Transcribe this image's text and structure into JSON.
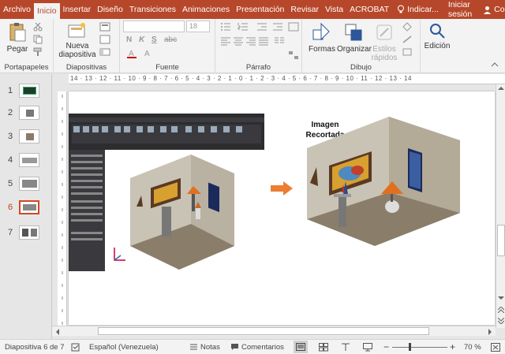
{
  "tabs": [
    "Archivo",
    "Inicio",
    "Insertar",
    "Diseño",
    "Transiciones",
    "Animaciones",
    "Presentación",
    "Revisar",
    "Vista",
    "ACROBAT"
  ],
  "tell_me": "Indicar...",
  "signin": "Iniciar sesión",
  "share": "Compartir",
  "ribbon": {
    "paste": "Pegar",
    "clipboard_label": "Portapapeles",
    "new_slide_1": "Nueva",
    "new_slide_2": "diapositiva",
    "slides_label": "Diapositivas",
    "font_size": "18",
    "font_label": "Fuente",
    "paragraph_label": "Párrafo",
    "shapes": "Formas",
    "arrange": "Organizar",
    "quick_styles_1": "Estilos",
    "quick_styles_2": "rápidos",
    "drawing_label": "Dibujo",
    "edit": "Edición",
    "bold": "N",
    "italic": "K",
    "underline": "S",
    "strike": "abc"
  },
  "ruler": "14 · 13 · 12 · 11 · 10 · 9 · 8 · 7 · 6 · 5 · 4 · 3 · 2 · 1 · 0 · 1 · 2 · 3 · 4 · 5 · 6 · 7 · 8 · 9 · 10 · 11 · 12 · 13 · 14",
  "thumbnails": [
    "1",
    "2",
    "3",
    "4",
    "5",
    "6",
    "7"
  ],
  "slide": {
    "caption_1": "Imagen",
    "caption_2": "Recortada"
  },
  "status": {
    "slide_info": "Diapositiva 6 de 7",
    "language": "Español (Venezuela)",
    "notes": "Notas",
    "comments": "Comentarios",
    "zoom": "70 %"
  },
  "colors": {
    "accent": "#b7472a",
    "arrow": "#ed7d31"
  }
}
